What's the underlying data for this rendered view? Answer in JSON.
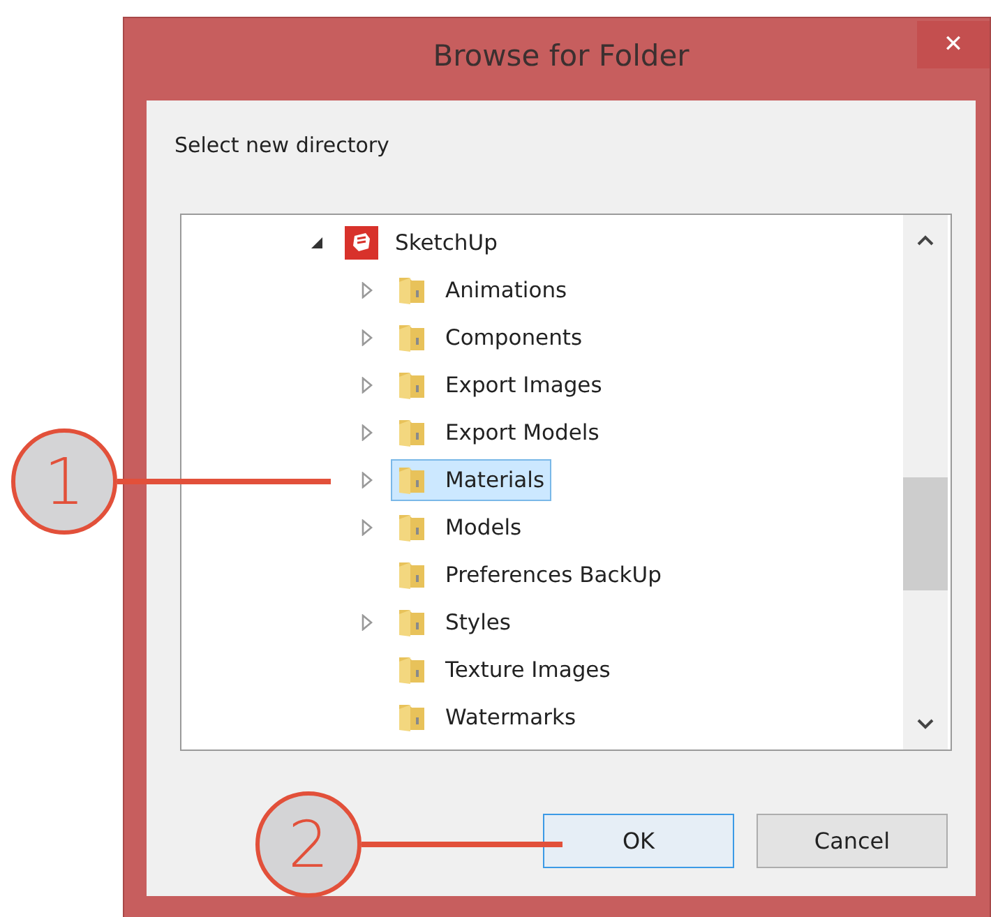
{
  "window": {
    "title": "Browse for Folder",
    "close": "✕"
  },
  "instruction": "Select new directory",
  "tree": [
    {
      "label": "SketchUp",
      "kind": "app",
      "expanded": true,
      "selected": false,
      "children": [
        {
          "label": "Animations",
          "kind": "folder",
          "expanded": false,
          "selected": false
        },
        {
          "label": "Components",
          "kind": "folder",
          "expanded": false,
          "selected": false
        },
        {
          "label": "Export Images",
          "kind": "folder",
          "expanded": false,
          "selected": false
        },
        {
          "label": "Export Models",
          "kind": "folder",
          "expanded": false,
          "selected": false
        },
        {
          "label": "Materials",
          "kind": "folder",
          "expanded": false,
          "selected": true
        },
        {
          "label": "Models",
          "kind": "folder",
          "expanded": false,
          "selected": false
        },
        {
          "label": "Preferences BackUp",
          "kind": "folder",
          "selected": false
        },
        {
          "label": "Styles",
          "kind": "folder",
          "expanded": false,
          "selected": false
        },
        {
          "label": "Texture Images",
          "kind": "folder",
          "selected": false
        },
        {
          "label": "Watermarks",
          "kind": "folder",
          "selected": false
        }
      ]
    }
  ],
  "buttons": [
    {
      "label": "OK",
      "default": true
    },
    {
      "label": "Cancel",
      "default": false
    }
  ],
  "callouts": [
    {
      "number": "1"
    },
    {
      "number": "2"
    }
  ]
}
